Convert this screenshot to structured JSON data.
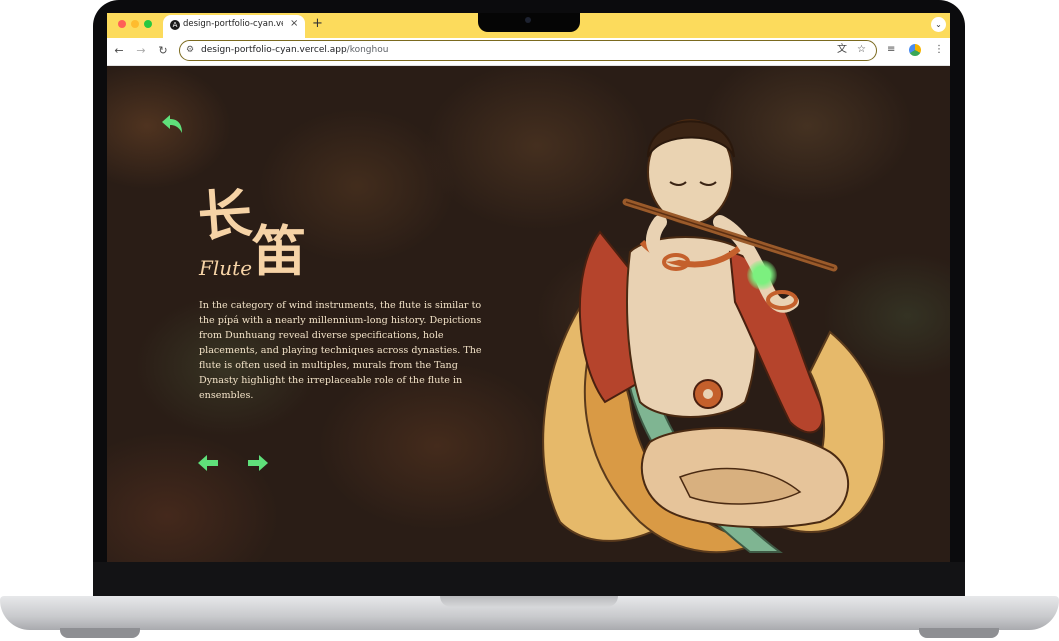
{
  "browser": {
    "tab_title": "design-portfolio-cyan.vercel",
    "tab_favicon": "A",
    "tab_close": "×",
    "new_tab": "+",
    "tab_menu": "⌄",
    "url_host": "design-portfolio-cyan.vercel.app",
    "url_path": "/konghou",
    "toolbar_icons": [
      "back-arrow-icon",
      "forward-arrow-icon",
      "reload-icon",
      "site-info-icon",
      "translate-icon",
      "bookmark-star-icon",
      "reading-list-icon",
      "extension-icon",
      "menu-kebab-icon"
    ]
  },
  "page": {
    "title_cn_1": "长",
    "title_cn_2": "笛",
    "title_en": "Flute",
    "description": "In the category of wind instruments, the flute is similar to the pípá with a nearly millennium-long history. Depictions from Dunhuang reveal diverse specifications, hole placements, and playing techniques across dynasties. The flute is often used in multiples, murals from the Tang Dynasty highlight the irreplaceable role of the flute in ensembles.",
    "accent_color": "#5fe07a",
    "text_color": "#f6d3a6",
    "background_color": "#2a1d16"
  }
}
